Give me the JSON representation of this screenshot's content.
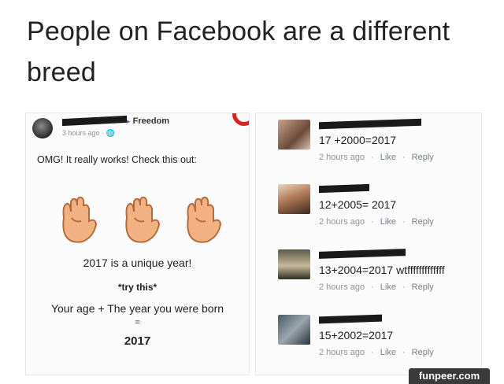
{
  "title": "People on Facebook are a different breed",
  "post": {
    "group": "Freedom",
    "meta": "3 hours ago · 🌐",
    "text": "OMG! It really works! Check this out:",
    "line1": "2017 is a unique year!",
    "line2": "*try this*",
    "line3": "Your age + The year you were born",
    "line4": "=",
    "line5": "2017",
    "hand_color": "#f2b183"
  },
  "comments": [
    {
      "text": "17 +2000=2017",
      "time": "2 hours ago",
      "like": "Like",
      "reply": "Reply"
    },
    {
      "text": "12+2005= 2017",
      "time": "2 hours ago",
      "like": "Like",
      "reply": "Reply"
    },
    {
      "text": "13+2004=2017 wtfffffffffffff",
      "time": "2 hours ago",
      "like": "Like",
      "reply": "Reply"
    },
    {
      "text": "15+2002=2017",
      "time": "2 hours ago",
      "like": "Like",
      "reply": "Reply"
    }
  ],
  "watermark": "funpeer.com"
}
